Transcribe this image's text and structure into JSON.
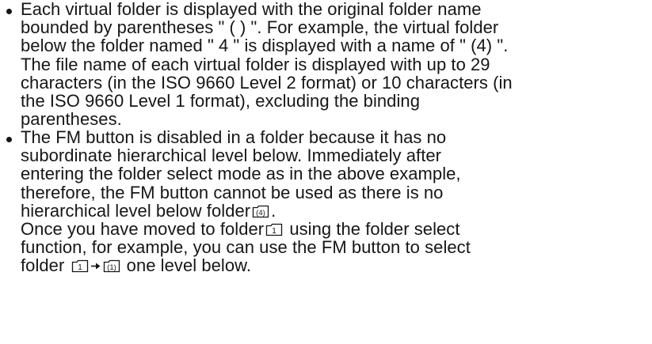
{
  "bullets": [
    {
      "lines": [
        "Each virtual folder is displayed with the original folder name",
        "bounded by parentheses \" ( ) \". For example, the virtual folder",
        "below the folder named \" 4 \" is displayed with a name of \" (4) \".",
        "The file name of each virtual folder is displayed with up to 29",
        "characters (in the ISO 9660 Level 2 format) or 10 characters (in",
        "the ISO 9660 Level 1 format), excluding the binding",
        "parentheses."
      ]
    },
    {
      "lines": [
        "The FM button is disabled in a folder because it has no",
        "subordinate hierarchical level below.  Immediately after",
        "entering the folder select mode as in the above example,",
        "therefore, the FM button cannot be used as there is no"
      ],
      "line5": {
        "before": "hierarchical level below folder",
        "after": "."
      },
      "line6": {
        "before": "Once you have moved to folder",
        "after": " using the folder select"
      },
      "line7": "function, for example, you can use the FM button to select",
      "line8": {
        "before": "folder ",
        "after": " one level below."
      }
    }
  ],
  "icons": {
    "folder_4": "(4)",
    "folder_1": "1",
    "folder_1_virtual": "(1)",
    "arrow": "→"
  }
}
